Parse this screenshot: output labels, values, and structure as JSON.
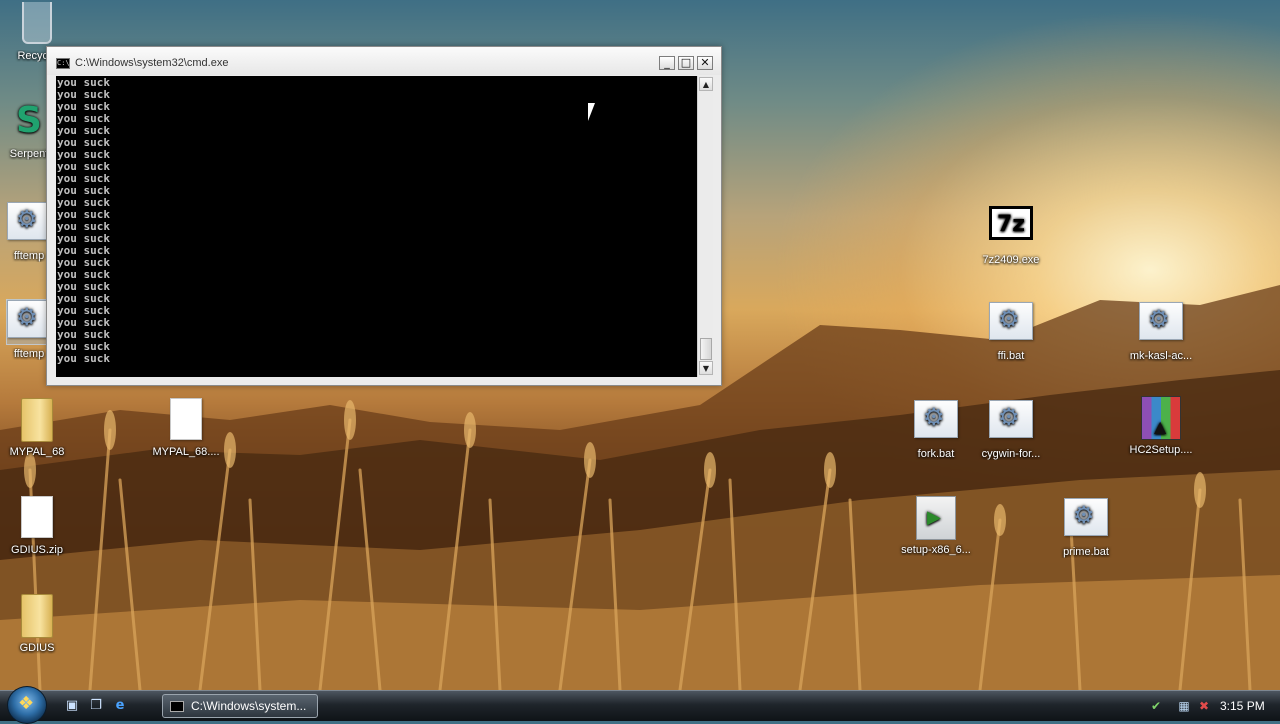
{
  "desktop": {
    "icons": [
      {
        "label": "Recycle",
        "icon": "recycle-bin-icon"
      },
      {
        "label": "Serpent",
        "icon": "serpent-shortcut-icon"
      },
      {
        "label": "fftemp",
        "icon": "fftemp-icon"
      },
      {
        "label": "fftemp",
        "icon": "batch-file-icon"
      },
      {
        "label": "MYPAL_68",
        "icon": "folder-icon"
      },
      {
        "label": "MYPAL_68....",
        "icon": "document-icon"
      },
      {
        "label": "GDIUS.zip",
        "icon": "zip-file-icon"
      },
      {
        "label": "GDIUS",
        "icon": "folder-icon"
      },
      {
        "label": "7z2409.exe",
        "icon": "7zip-icon"
      },
      {
        "label": "ffi.bat",
        "icon": "batch-file-icon"
      },
      {
        "label": "mk-kasl-ac...",
        "icon": "batch-file-icon"
      },
      {
        "label": "fork.bat",
        "icon": "batch-file-icon"
      },
      {
        "label": "cygwin-for...",
        "icon": "batch-file-icon"
      },
      {
        "label": "HC2Setup....",
        "icon": "winrar-archive-icon"
      },
      {
        "label": "setup-x86_6...",
        "icon": "cygwin-setup-icon"
      },
      {
        "label": "prime.bat",
        "icon": "batch-file-icon"
      }
    ]
  },
  "console_window": {
    "title": "C:\\Windows\\system32\\cmd.exe",
    "minimize": "_",
    "maximize": "□",
    "close": "✕",
    "output_lines": [
      "you suck",
      "you suck",
      "you suck",
      "you suck",
      "you suck",
      "you suck",
      "you suck",
      "you suck",
      "you suck",
      "you suck",
      "you suck",
      "you suck",
      "you suck",
      "you suck",
      "you suck",
      "you suck",
      "you suck",
      "you suck",
      "you suck",
      "you suck",
      "you suck",
      "you suck",
      "you suck",
      "you suck"
    ],
    "scroll_up": "▲",
    "scroll_down": "▼"
  },
  "taskbar": {
    "start_icon": "windows-start-orb-icon",
    "quick_launch": [
      {
        "icon": "show-desktop-icon",
        "glyph": "▣"
      },
      {
        "icon": "switch-windows-icon",
        "glyph": "❐"
      },
      {
        "icon": "internet-explorer-icon",
        "glyph": "e"
      }
    ],
    "task_button": {
      "label": "C:\\Windows\\system...",
      "icon": "cmd-icon"
    },
    "tray_icons": [
      {
        "icon": "safely-remove-hardware-icon",
        "glyph": "✔",
        "color": "#7fd36a"
      },
      {
        "icon": "network-icon",
        "glyph": "▦",
        "color": "#bcd7f2"
      },
      {
        "icon": "volume-muted-icon",
        "glyph": "✖",
        "color": "#e14b4b"
      }
    ],
    "clock": "3:15 PM"
  }
}
